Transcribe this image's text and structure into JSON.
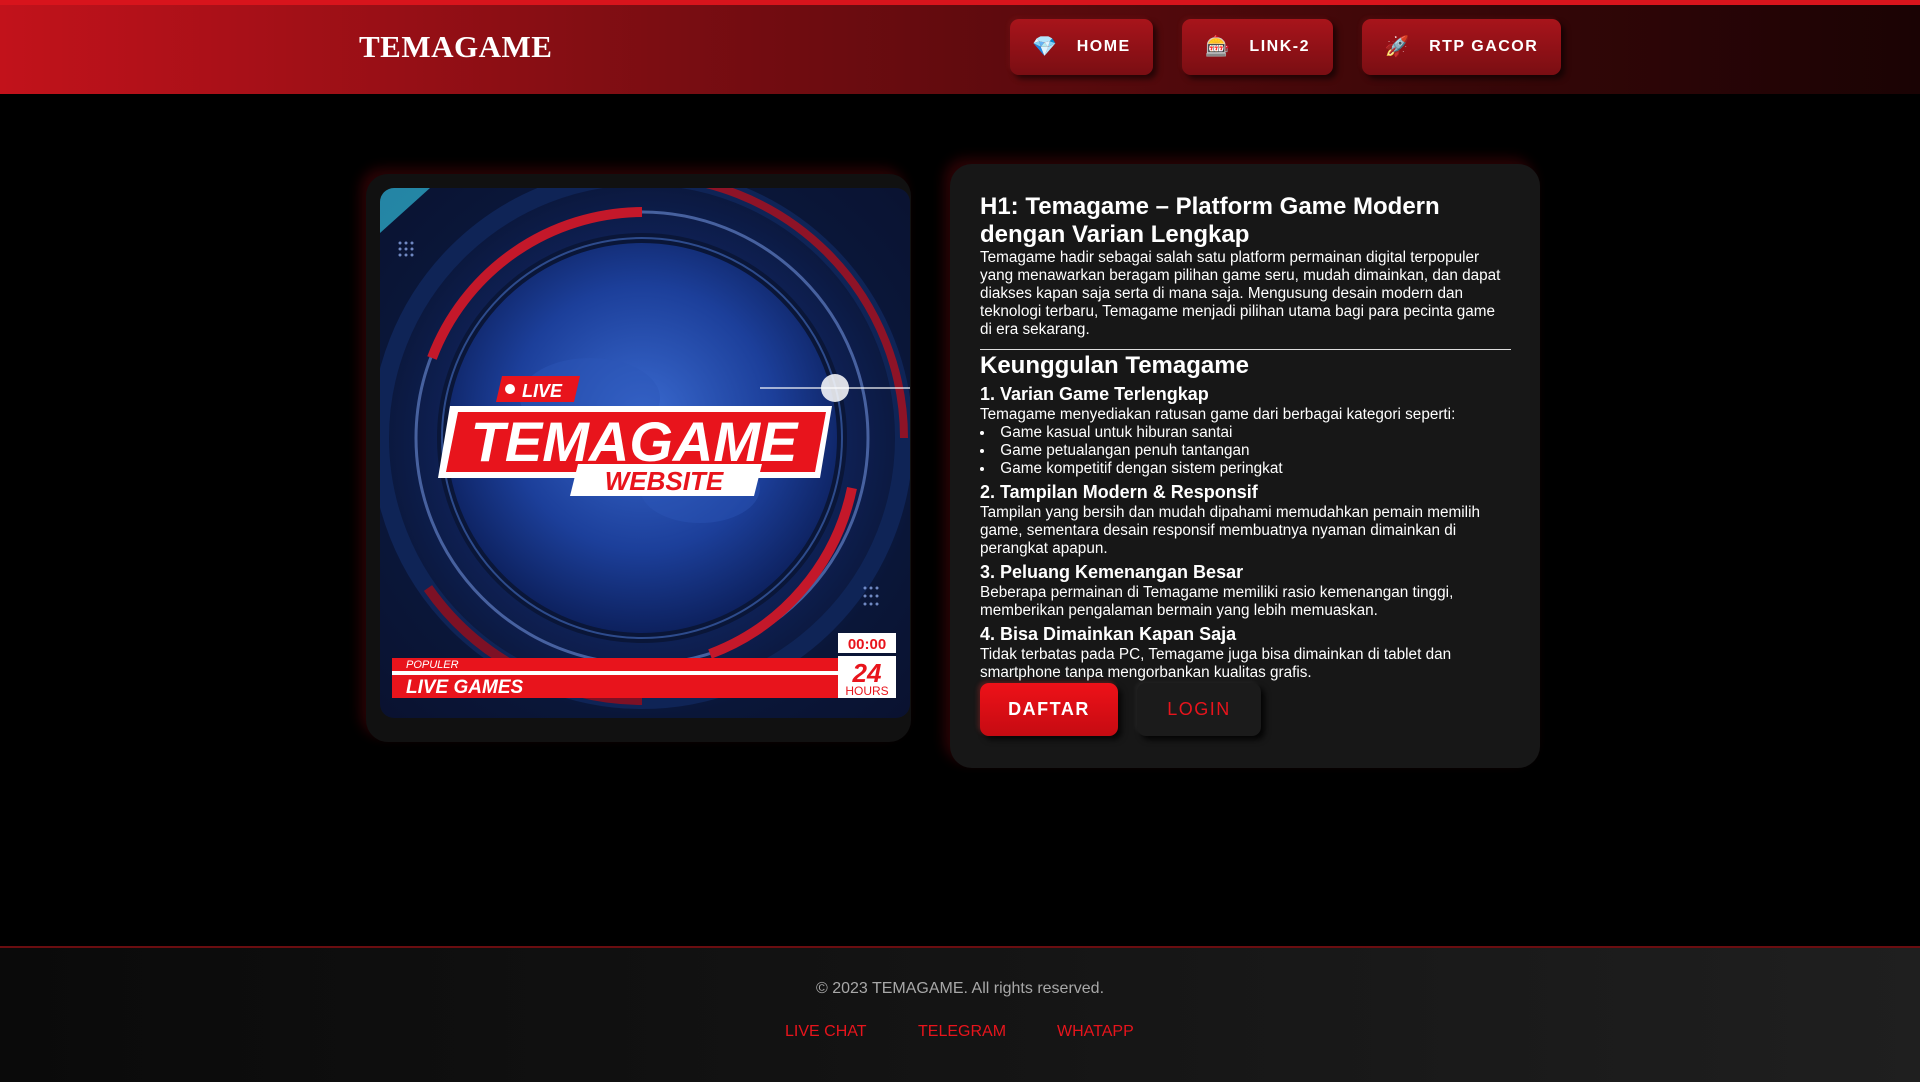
{
  "header": {
    "logo": "TEMAGAME",
    "nav": [
      {
        "label": "HOME",
        "icon": "gem-icon",
        "glyph": "💎"
      },
      {
        "label": "LINK-2",
        "icon": "slot-machine-icon",
        "glyph": "🎰"
      },
      {
        "label": "RTP GACOR",
        "icon": "rocket-icon",
        "glyph": "🚀"
      }
    ]
  },
  "hero": {
    "live": "LIVE",
    "brand": "TEMAGAME",
    "website": "WEBSITE",
    "populer": "POPULER",
    "live_games": "LIVE GAMES",
    "clock": "00:00",
    "hours_num": "24",
    "hours_label": "HOURS"
  },
  "article": {
    "h1": "H1: Temagame – Platform Game Modern dengan Varian Lengkap",
    "intro": "Temagame hadir sebagai salah satu platform permainan digital terpopuler yang menawarkan beragam pilihan game seru, mudah dimainkan, dan dapat diakses kapan saja serta di mana saja. Mengusung desain modern dan teknologi terbaru, Temagame menjadi pilihan utama bagi para pecinta game di era sekarang.",
    "h2": "Keunggulan Temagame",
    "s1_title": "1. Varian Game Terlengkap",
    "s1_text": "Temagame menyediakan ratusan game dari berbagai kategori seperti:",
    "s1_items": [
      "Game kasual untuk hiburan santai",
      "Game petualangan penuh tantangan",
      "Game kompetitif dengan sistem peringkat"
    ],
    "s2_title": "2. Tampilan Modern & Responsif",
    "s2_text": "Tampilan yang bersih dan mudah dipahami memudahkan pemain memilih game, sementara desain responsif membuatnya nyaman dimainkan di perangkat apapun.",
    "s3_title": "3. Peluang Kemenangan Besar",
    "s3_text": "Beberapa permainan di Temagame memiliki rasio kemenangan tinggi, memberikan pengalaman bermain yang lebih memuaskan.",
    "s4_title": "4. Bisa Dimainkan Kapan Saja",
    "s4_text": "Tidak terbatas pada PC, Temagame juga bisa dimainkan di tablet dan smartphone tanpa mengorbankan kualitas grafis."
  },
  "buttons": {
    "daftar": "DAFTAR",
    "login": "LOGIN"
  },
  "footer": {
    "copyright": "© 2023 TEMAGAME. All rights reserved.",
    "links": [
      "LIVE CHAT",
      "TELEGRAM",
      "WHATAPP"
    ]
  },
  "colors": {
    "accent": "#e8141c",
    "header_dark": "#1a0304",
    "card": "#171717",
    "background": "#000000"
  }
}
